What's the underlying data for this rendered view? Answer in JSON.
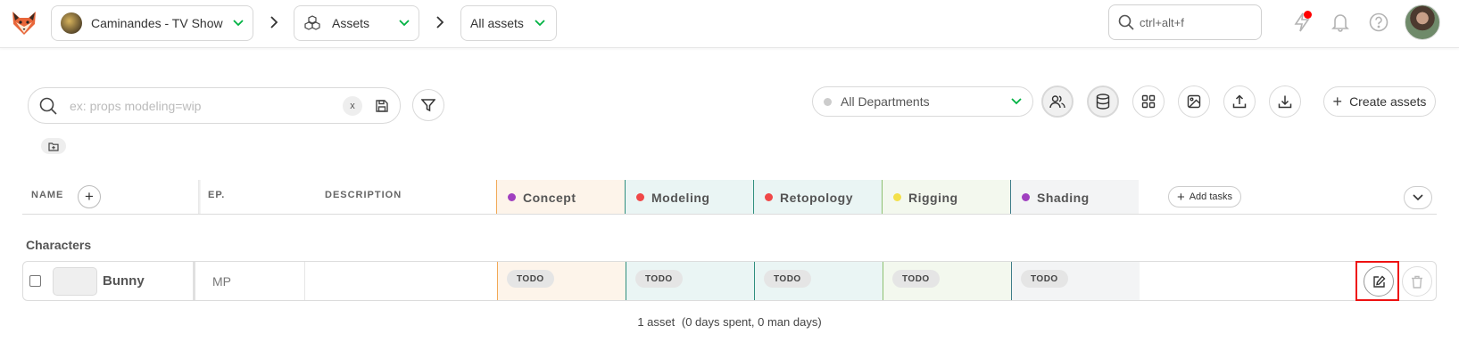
{
  "topbar": {
    "production": "Caminandes - TV Show",
    "section": "Assets",
    "view": "All assets",
    "search_placeholder": "ctrl+alt+f"
  },
  "toolbar": {
    "search_placeholder": "ex: props modeling=wip",
    "clear_label": "x",
    "department": "All Departments",
    "create_label": "Create assets"
  },
  "table": {
    "headers": {
      "name": "NAME",
      "episode": "EP.",
      "description": "DESCRIPTION"
    },
    "tasks": [
      {
        "name": "Concept",
        "color": "#a040c0",
        "bg": "#fdf4ea",
        "border": "#f2a957"
      },
      {
        "name": "Modeling",
        "color": "#f04848",
        "bg": "#eaf5f4",
        "border": "#2f8f7e"
      },
      {
        "name": "Retopology",
        "color": "#f04848",
        "bg": "#eaf5f4",
        "border": "#2f8f7e"
      },
      {
        "name": "Rigging",
        "color": "#f3e04a",
        "bg": "#f3f8ee",
        "border": "#8cc070"
      },
      {
        "name": "Shading",
        "color": "#a040c0",
        "bg": "#f3f4f5",
        "border": "#3f7d8a"
      }
    ],
    "add_tasks_label": "Add tasks",
    "group": "Characters",
    "rows": [
      {
        "name": "Bunny",
        "episode": "MP",
        "description": "",
        "statuses": [
          "TODO",
          "TODO",
          "TODO",
          "TODO",
          "TODO"
        ]
      }
    ]
  },
  "summary": {
    "count": "1 asset",
    "stats": "(0 days spent, 0 man days)"
  }
}
